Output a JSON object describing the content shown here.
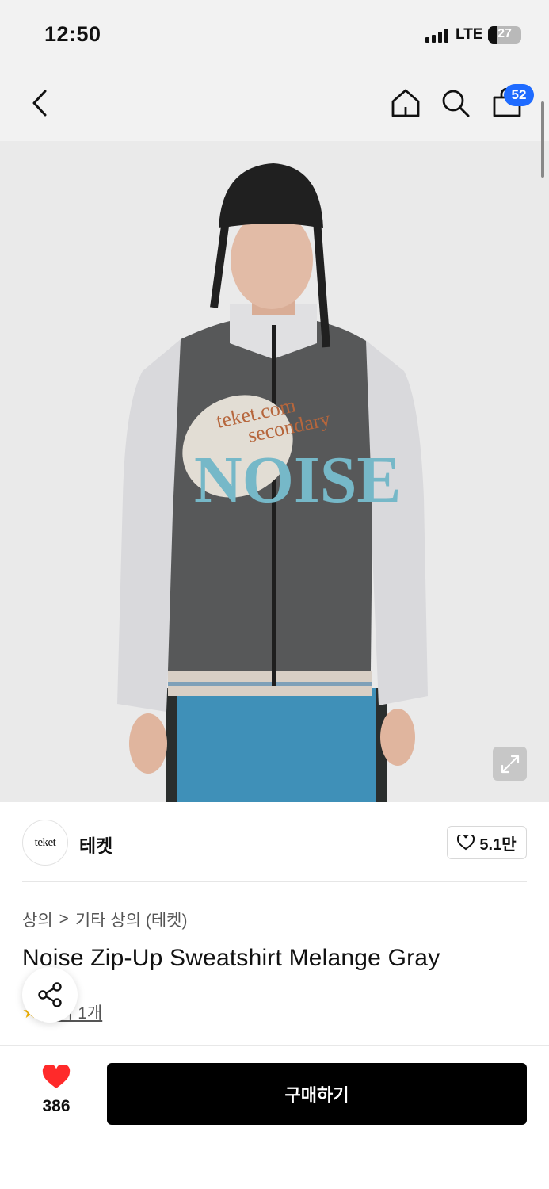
{
  "status_bar": {
    "time": "12:50",
    "network": "LTE",
    "battery": "27",
    "battery_level": 0.27
  },
  "nav": {
    "back_icon": "chevron-left-icon",
    "home_icon": "home-icon",
    "search_icon": "search-icon",
    "cart_icon": "shopping-bag-icon",
    "cart_count": "52",
    "accent_color": "#1f6bff"
  },
  "product_image": {
    "graphic_text_1": "teket.com",
    "graphic_text_2": "secondary",
    "graphic_text_3": "NOISE",
    "expand_icon": "expand-icon"
  },
  "brand": {
    "logo_text": "teket",
    "name": "테켓",
    "likes": "5.1만",
    "like_icon": "heart-outline-icon"
  },
  "breadcrumb": {
    "category": "상의",
    "separator": ">",
    "subcategory": "기타 상의 (테켓)"
  },
  "product": {
    "title": "Noise Zip-Up Sweatshirt Melange Gray",
    "review_label": "후기 1개"
  },
  "share": {
    "icon": "share-icon"
  },
  "bottom_bar": {
    "wish_count": "386",
    "wish_icon": "heart-filled-icon",
    "wish_color": "#ff2a2a",
    "buy_label": "구매하기",
    "buy_color": "#000000"
  }
}
